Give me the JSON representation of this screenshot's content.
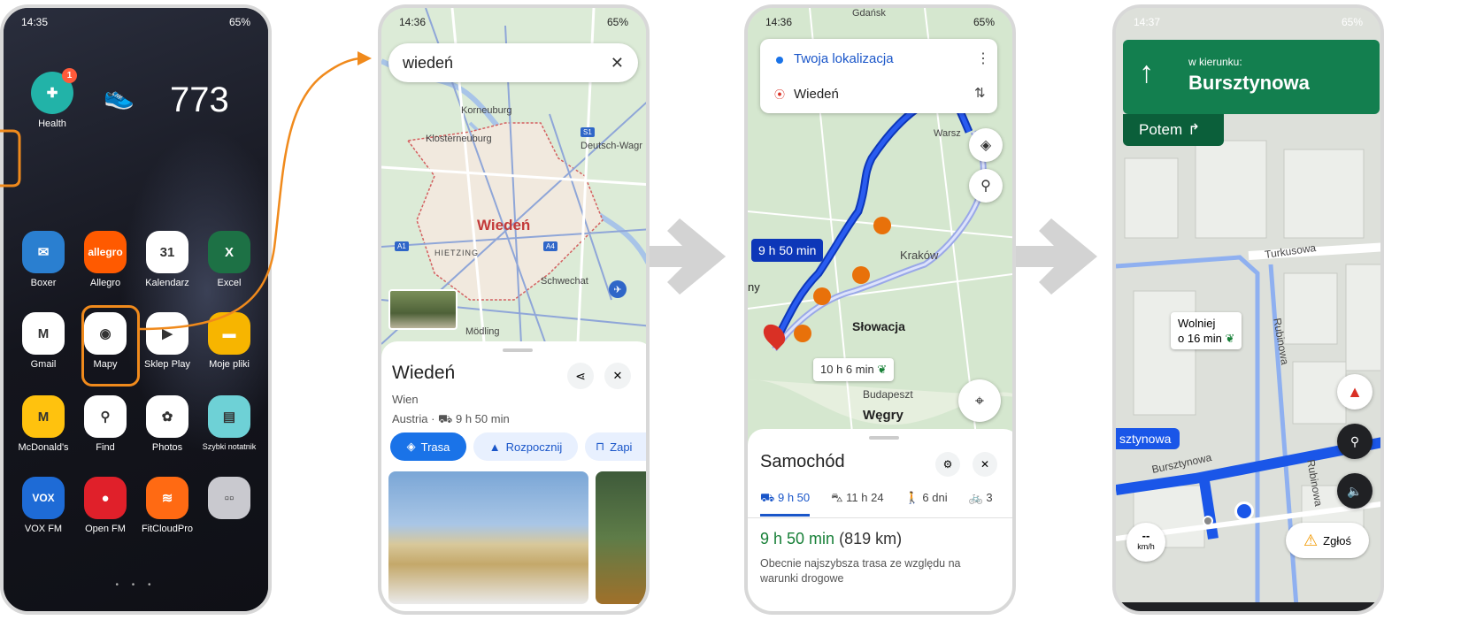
{
  "phone1": {
    "status_time": "14:35",
    "status_right": "65%",
    "step_count": "773",
    "health_badge": "1",
    "apps": [
      {
        "label": "Health",
        "color": "#22b3a8",
        "glyph": "✚"
      },
      {
        "label": "Boxer",
        "color": "#2a7fd0",
        "glyph": "✉"
      },
      {
        "label": "Allegro",
        "color": "#ff5a00",
        "glyph": "allegro"
      },
      {
        "label": "Kalendarz",
        "color": "#ffffff",
        "glyph": "31"
      },
      {
        "label": "Excel",
        "color": "#1d7145",
        "glyph": "X"
      },
      {
        "label": "Gmail",
        "color": "#ffffff",
        "glyph": "M"
      },
      {
        "label": "Mapy",
        "color": "#ffffff",
        "glyph": "◉"
      },
      {
        "label": "Sklep Play",
        "color": "#ffffff",
        "glyph": "▶"
      },
      {
        "label": "Moje pliki",
        "color": "#f7b500",
        "glyph": "▬"
      },
      {
        "label": "McDonald's",
        "color": "#ffc20e",
        "glyph": "M"
      },
      {
        "label": "Find",
        "color": "#ffffff",
        "glyph": "⚲"
      },
      {
        "label": "Photos",
        "color": "#ffffff",
        "glyph": "✿"
      },
      {
        "label": "Szybki notatnik",
        "color": "#6ed1d6",
        "glyph": "▤"
      },
      {
        "label": "VOX FM",
        "color": "#1e6bd6",
        "glyph": "VOX"
      },
      {
        "label": "Open FM",
        "color": "#e0202a",
        "glyph": "●"
      },
      {
        "label": "FitCloudPro",
        "color": "#ff6a13",
        "glyph": "≋"
      },
      {
        "label": "",
        "color": "#c9c9cf",
        "glyph": "▫▫"
      }
    ],
    "page_dots": "• • •"
  },
  "phone2": {
    "status_time": "14:36",
    "status_right": "65%",
    "search_value": "wiedeń",
    "map_labels": [
      "Korneuburg",
      "Klosterneuburg",
      "Deutsch-Wagr",
      "HIETZING",
      "Schwechat",
      "Mödling"
    ],
    "city_label": "Wiedeń",
    "place_title": "Wiedeń",
    "place_sub": "Wien",
    "place_meta": "Austria · ⛟ 9 h 50 min",
    "btn_route": "Trasa",
    "btn_start": "Rozpocznij",
    "btn_save": "Zapi",
    "road_badges": [
      "A1",
      "A4",
      "S1"
    ]
  },
  "phone3": {
    "status_time": "14:36",
    "status_right": "65%",
    "from": "Twoja lokalizacja",
    "to": "Wiedeń",
    "route_time_main": "9 h 50 min",
    "route_time_alt": "10 h 6 min",
    "map_labels": [
      "Warsz",
      "Kraków",
      "Słowacja",
      "Budapeszt",
      "Węgry",
      "ny",
      "Gdańsk"
    ],
    "mode_title": "Samochód",
    "modes": [
      {
        "icon": "⛟",
        "label": "9 h 50"
      },
      {
        "icon": "⛍",
        "label": "11 h 24"
      },
      {
        "icon": "🚶",
        "label": "6 dni"
      },
      {
        "icon": "🚲",
        "label": "3"
      }
    ],
    "summary_time": "9 h 50 min",
    "summary_dist": "(819 km)",
    "summary_note": "Obecnie najszybsza trasa ze względu na warunki drogowe"
  },
  "phone4": {
    "status_time": "14:37",
    "status_right": "65%",
    "direction_label": "w kierunku:",
    "direction_street": "Bursztynowa",
    "then_label": "Potem",
    "streets": [
      "Turkusowa",
      "Rubinowa",
      "Bursztynowa",
      "Rubinowa"
    ],
    "current_street": "sztynowa",
    "slower_line1": "Wolniej",
    "slower_line2": "o 16 min",
    "speed_value": "--",
    "speed_unit": "km/h",
    "report_label": "Zgłoś"
  },
  "colors": {
    "accent": "#f08a1c",
    "maps_green": "#137f4f",
    "route_blue": "#1a56e8",
    "arrow_grey": "#d3d3d3"
  }
}
